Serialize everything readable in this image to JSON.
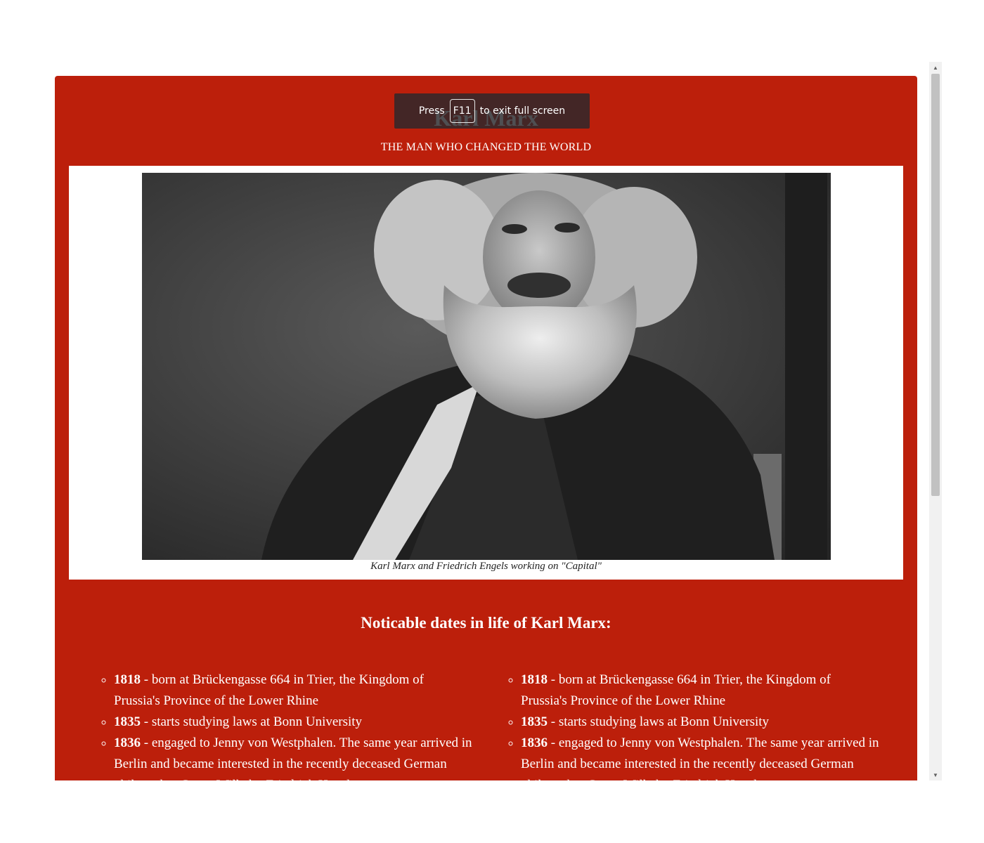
{
  "header": {
    "title": "Karl Marx",
    "subtitle": "THE MAN WHO CHANGED THE WORLD"
  },
  "figure": {
    "caption": "Karl Marx and Friedrich Engels working on \"Capital\""
  },
  "dates_section": {
    "heading": "Noticable dates in life of Karl Marx:",
    "columns": [
      [
        {
          "year": "1818",
          "text": " - born at Brückengasse 664 in Trier, the Kingdom of Prussia's Province of the Lower Rhine"
        },
        {
          "year": "1835",
          "text": " - starts studying laws at Bonn University"
        },
        {
          "year": "1836",
          "text": " - engaged to Jenny von Westphalen. The same year arrived in Berlin and became interested in the recently deceased German philosopher Georg Wilhelm Friedrich Hegel"
        }
      ],
      [
        {
          "year": "1818",
          "text": " - born at Brückengasse 664 in Trier, the Kingdom of Prussia's Province of the Lower Rhine"
        },
        {
          "year": "1835",
          "text": " - starts studying laws at Bonn University"
        },
        {
          "year": "1836",
          "text": " - engaged to Jenny von Westphalen. The same year arrived in Berlin and became interested in the recently deceased German philosopher Georg Wilhelm Friedrich Hegel"
        }
      ]
    ]
  },
  "fullscreen_notice": {
    "before": "Press",
    "key": "F11",
    "after": "to exit full screen"
  },
  "colors": {
    "page_background": "#bc1f0b",
    "figure_background": "#ffffff",
    "text": "#ffffff"
  },
  "icons": {
    "scroll_up": "triangle-up-icon",
    "scroll_down": "triangle-down-icon"
  }
}
